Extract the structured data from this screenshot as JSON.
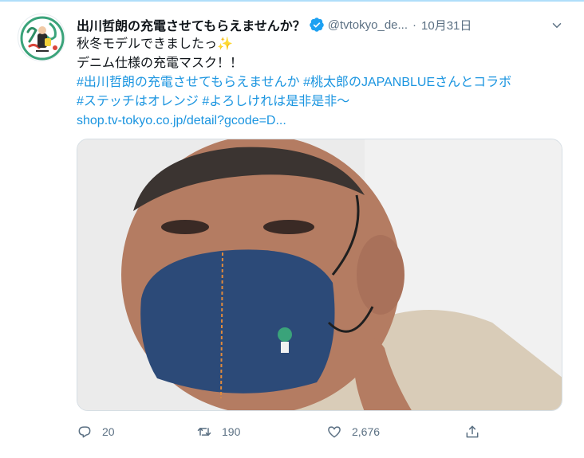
{
  "tweet": {
    "display_name": "出川哲朗の充電させてもらえませんか？",
    "handle": "@tvtokyo_de...",
    "separator": "·",
    "timestamp": "10月31日",
    "lines": [
      "秋冬モデルできましたっ",
      "デニム仕様の充電マスク！！"
    ],
    "sparkle_emoji": "✨",
    "hashtag_line_1": "#出川哲朗の充電させてもらえませんか #桃太郎のJAPANBLUEさんとコラボ",
    "hashtag_line_2": "#ステッチはオレンジ #よろしけれは是非是非〜",
    "link": "shop.tv-tokyo.co.jp/detail?gcode=D..."
  },
  "actions": {
    "reply_count": "20",
    "retweet_count": "190",
    "like_count": "2,676"
  },
  "icons": [
    "verified-badge-icon",
    "chevron-down-icon",
    "reply-icon",
    "retweet-icon",
    "like-icon",
    "share-icon"
  ],
  "colors": {
    "accent": "#1da1f2",
    "link": "#1b95e0",
    "secondary_text": "#5b7083",
    "mask_denim": "#2c4a78"
  }
}
